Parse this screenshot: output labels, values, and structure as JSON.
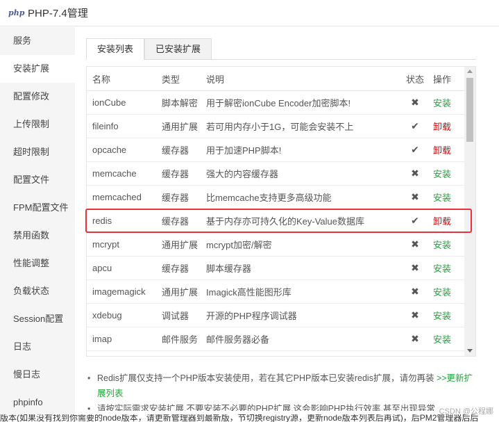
{
  "window": {
    "logo_text": "php",
    "title": "PHP-7.4管理"
  },
  "sidebar": {
    "items": [
      {
        "label": "服务"
      },
      {
        "label": "安装扩展",
        "active": true
      },
      {
        "label": "配置修改"
      },
      {
        "label": "上传限制"
      },
      {
        "label": "超时限制"
      },
      {
        "label": "配置文件"
      },
      {
        "label": "FPM配置文件"
      },
      {
        "label": "禁用函数"
      },
      {
        "label": "性能调整"
      },
      {
        "label": "负载状态"
      },
      {
        "label": "Session配置"
      },
      {
        "label": "日志"
      },
      {
        "label": "慢日志"
      },
      {
        "label": "phpinfo"
      }
    ]
  },
  "tabs": [
    {
      "label": "安装列表",
      "active": true
    },
    {
      "label": "已安装扩展"
    }
  ],
  "table": {
    "headers": {
      "name": "名称",
      "type": "类型",
      "desc": "说明",
      "status": "状态",
      "action": "操作"
    },
    "rows": [
      {
        "name": "ionCube",
        "type": "脚本解密",
        "desc": "用于解密ionCube Encoder加密脚本!",
        "status": "✖",
        "action": "安装"
      },
      {
        "name": "fileinfo",
        "type": "通用扩展",
        "desc": "若可用内存小于1G，可能会安装不上",
        "status": "✔",
        "action": "卸载"
      },
      {
        "name": "opcache",
        "type": "缓存器",
        "desc": "用于加速PHP脚本!",
        "status": "✔",
        "action": "卸载"
      },
      {
        "name": "memcache",
        "type": "缓存器",
        "desc": "强大的内容缓存器",
        "status": "✖",
        "action": "安装"
      },
      {
        "name": "memcached",
        "type": "缓存器",
        "desc": "比memcache支持更多高级功能",
        "status": "✖",
        "action": "安装"
      },
      {
        "name": "redis",
        "type": "缓存器",
        "desc": "基于内存亦可持久化的Key-Value数据库",
        "status": "✔",
        "action": "卸载"
      },
      {
        "name": "mcrypt",
        "type": "通用扩展",
        "desc": "mcrypt加密/解密",
        "status": "✖",
        "action": "安装"
      },
      {
        "name": "apcu",
        "type": "缓存器",
        "desc": "脚本缓存器",
        "status": "✖",
        "action": "安装"
      },
      {
        "name": "imagemagick",
        "type": "通用扩展",
        "desc": "Imagick高性能图形库",
        "status": "✖",
        "action": "安装"
      },
      {
        "name": "xdebug",
        "type": "调试器",
        "desc": "开源的PHP程序调试器",
        "status": "✖",
        "action": "安装"
      },
      {
        "name": "imap",
        "type": "邮件服务",
        "desc": "邮件服务器必备",
        "status": "✖",
        "action": "安装"
      }
    ]
  },
  "notes": {
    "note1": "Redis扩展仅支持一个PHP版本安装使用，若在其它PHP版本已安装redis扩展，请勿再装",
    "note1_link": ">>更新扩展列表",
    "note2": "请按实际需求安装扩展,不要安装不必要的PHP扩展,这会影响PHP执行效率,甚至出现异常"
  },
  "overlay_text": "版本(如果没有找到你需要的node版本，请更新管理器到最新版，节切换registry源，更新node版本列表后再试)，后PM2管理器后后",
  "watermark": "CSDN @公程娜"
}
